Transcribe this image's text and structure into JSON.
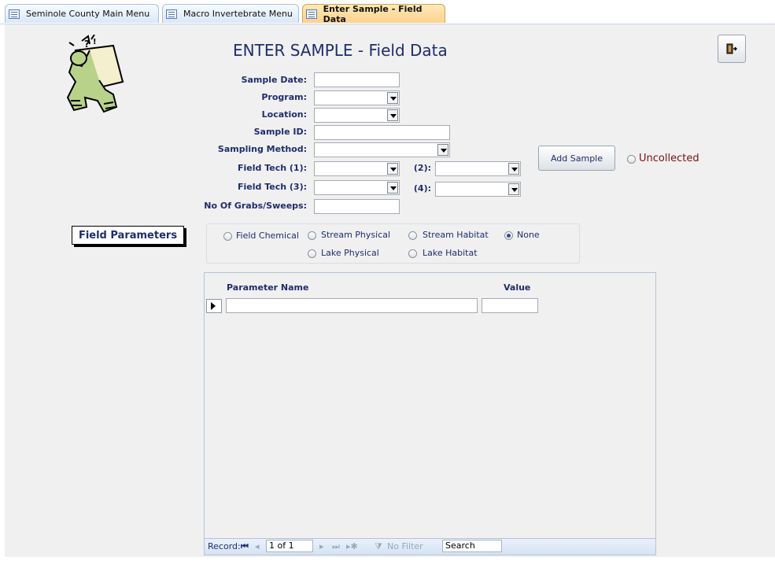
{
  "tabs": [
    {
      "label": "Seminole County Main Menu",
      "active": false
    },
    {
      "label": "Macro Invertebrate Menu",
      "active": false
    },
    {
      "label": "Enter Sample - Field Data",
      "active": true
    }
  ],
  "form": {
    "title": "ENTER SAMPLE - Field Data",
    "labels": {
      "sample_date": "Sample Date:",
      "program": "Program:",
      "location": "Location:",
      "sample_id": "Sample ID:",
      "sampling_method": "Sampling Method:",
      "field_tech_1": "Field Tech (1):",
      "field_tech_2": "(2):",
      "field_tech_3": "Field Tech (3):",
      "field_tech_4": "(4):",
      "grabs": "No Of Grabs/Sweeps:"
    },
    "values": {
      "sample_date": "",
      "program": "",
      "location": "",
      "sample_id": "",
      "sampling_method": "",
      "field_tech_1": "",
      "field_tech_2": "",
      "field_tech_3": "",
      "field_tech_4": "",
      "grabs": ""
    },
    "add_button": "Add Sample",
    "uncollected": "Uncollected",
    "field_params_label": "Field Parameters",
    "param_options": [
      {
        "label": "Field Chemical",
        "selected": false
      },
      {
        "label": "Stream Physical",
        "selected": false
      },
      {
        "label": "Stream Habitat",
        "selected": false
      },
      {
        "label": "None",
        "selected": true
      },
      {
        "label": "Lake Physical",
        "selected": false
      },
      {
        "label": "Lake Habitat",
        "selected": false
      }
    ]
  },
  "subform": {
    "col_parameter": "Parameter Name",
    "col_value": "Value",
    "nav": {
      "record_label": "Record:",
      "position": "1 of 1",
      "filter": "No Filter",
      "search": "Search"
    }
  },
  "colors": {
    "accent": "#1f2d6d",
    "active_tab": "#fdd18b",
    "uncollected": "#7a1010"
  },
  "icons": {
    "exit": "exit-door-icon",
    "nav_first": "first-record-icon",
    "nav_prev": "prev-record-icon",
    "nav_next": "next-record-icon",
    "nav_last": "last-record-icon",
    "nav_new": "new-record-icon",
    "filter": "filter-icon"
  }
}
